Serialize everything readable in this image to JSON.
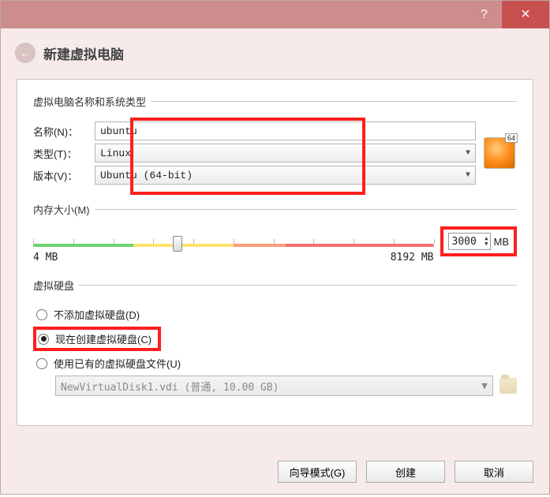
{
  "titlebar": {
    "help": "?",
    "close": "×"
  },
  "header": {
    "title": "新建虚拟电脑",
    "back_glyph": "←"
  },
  "group_name": {
    "legend": "虚拟电脑名称和系统类型",
    "name_label": "名称(N)：",
    "name_value": "ubuntu",
    "type_label": "类型(T)：",
    "type_value": "Linux",
    "version_label": "版本(V)：",
    "version_value": "Ubuntu (64-bit)",
    "arch_badge": "64"
  },
  "group_memory": {
    "legend": "内存大小(M)",
    "min_label": "4 MB",
    "max_label": "8192 MB",
    "value": "3000",
    "unit": "MB",
    "slider_min": 4,
    "slider_max": 8192,
    "slider_value": 3000
  },
  "group_disk": {
    "legend": "虚拟硬盘",
    "opt_none": "不添加虚拟硬盘(D)",
    "opt_create": "现在创建虚拟硬盘(C)",
    "opt_existing": "使用已有的虚拟硬盘文件(U)",
    "selected": "opt_create",
    "existing_value": "NewVirtualDisk1.vdi (普通, 10.00 GB)"
  },
  "footer": {
    "expert": "向导模式(G)",
    "create": "创建",
    "cancel": "取消"
  }
}
